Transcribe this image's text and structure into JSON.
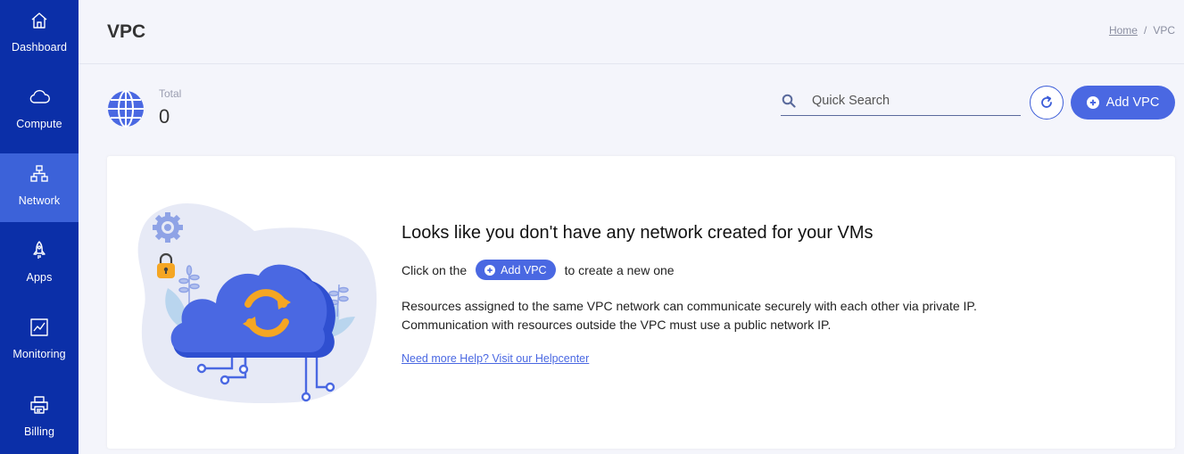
{
  "sidebar": {
    "items": [
      {
        "label": "Dashboard",
        "icon": "home-icon",
        "active": false
      },
      {
        "label": "Compute",
        "icon": "cloud-icon",
        "active": false
      },
      {
        "label": "Network",
        "icon": "network-icon",
        "active": true
      },
      {
        "label": "Apps",
        "icon": "rocket-icon",
        "active": false
      },
      {
        "label": "Monitoring",
        "icon": "chart-icon",
        "active": false
      },
      {
        "label": "Billing",
        "icon": "printer-icon",
        "active": false
      }
    ]
  },
  "header": {
    "title": "VPC",
    "breadcrumb": {
      "home": "Home",
      "separator": "/",
      "current": "VPC"
    }
  },
  "toolbar": {
    "total_label": "Total",
    "total_value": "0",
    "search_placeholder": "Quick Search",
    "add_label": "Add VPC"
  },
  "empty_state": {
    "headline": "Looks like you don't have any network created for your VMs",
    "cta_prefix": "Click on the",
    "cta_button": "Add VPC",
    "cta_suffix": "to create a new one",
    "desc_line1": "Resources assigned to the same VPC network can communicate securely with each other via private IP.",
    "desc_line2": "Communication with resources outside the VPC must use a public network IP.",
    "help_link": "Need more Help? Visit our Helpcenter"
  },
  "colors": {
    "sidebar_bg": "#0b2fa8",
    "sidebar_active": "#3c62d9",
    "accent": "#4a68e2",
    "page_bg": "#f4f5fb"
  }
}
